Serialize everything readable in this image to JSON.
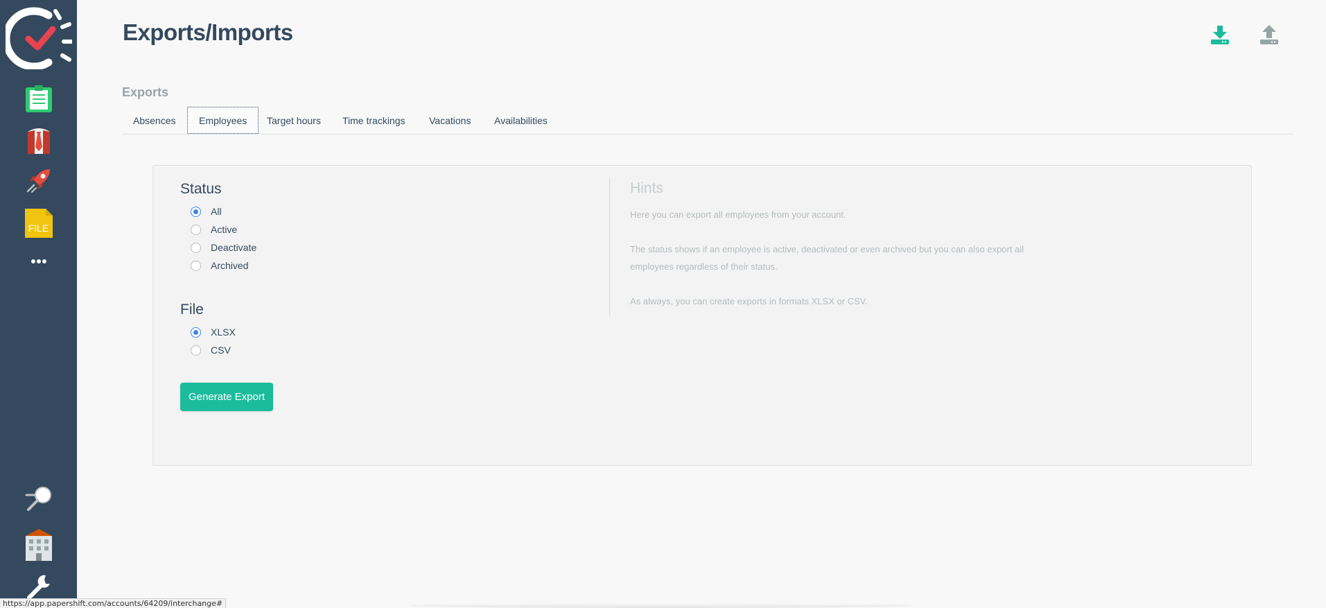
{
  "page": {
    "title": "Exports/Imports"
  },
  "header": {
    "download_icon": "download-icon",
    "upload_icon": "upload-icon",
    "download_color": "#1abc9c",
    "upload_color": "#95a5a6"
  },
  "sidebar": {
    "items": [
      {
        "name": "logo",
        "icon": "clock-check-icon"
      },
      {
        "name": "timesheet",
        "icon": "clipboard-icon"
      },
      {
        "name": "staff",
        "icon": "employee-icon"
      },
      {
        "name": "rocket",
        "icon": "rocket-icon"
      },
      {
        "name": "file",
        "icon": "file-icon",
        "label": "FILE"
      },
      {
        "name": "more",
        "icon": "more-icon"
      },
      {
        "name": "search",
        "icon": "magnifier-icon"
      },
      {
        "name": "building",
        "icon": "building-icon"
      },
      {
        "name": "settings",
        "icon": "wrench-icon"
      }
    ]
  },
  "exports": {
    "section_title": "Exports",
    "tabs": [
      {
        "label": "Absences",
        "active": false
      },
      {
        "label": "Employees",
        "active": true
      },
      {
        "label": "Target hours",
        "active": false
      },
      {
        "label": "Time trackings",
        "active": false
      },
      {
        "label": "Vacations",
        "active": false
      },
      {
        "label": "Availabilities",
        "active": false
      }
    ]
  },
  "form": {
    "status": {
      "title": "Status",
      "options": [
        {
          "label": "All",
          "checked": true
        },
        {
          "label": "Active",
          "checked": false
        },
        {
          "label": "Deactivate",
          "checked": false
        },
        {
          "label": "Archived",
          "checked": false
        }
      ]
    },
    "file": {
      "title": "File",
      "options": [
        {
          "label": "XLSX",
          "checked": true
        },
        {
          "label": "CSV",
          "checked": false
        }
      ]
    },
    "generate_button": "Generate Export"
  },
  "hints": {
    "title": "Hints",
    "paragraphs": [
      "Here you can export all employees from your account.",
      "The status shows if an employee is active, deactivated or even archived but you can also export all employees regardless of their status.",
      "As always, you can create exports in formats XLSX or CSV."
    ]
  },
  "statusbar": {
    "url": "https://app.papershift.com/accounts/64209/interchange#"
  },
  "colors": {
    "sidebar": "#34495e",
    "accent": "#1abc9c",
    "radio": "#3d86e8"
  }
}
